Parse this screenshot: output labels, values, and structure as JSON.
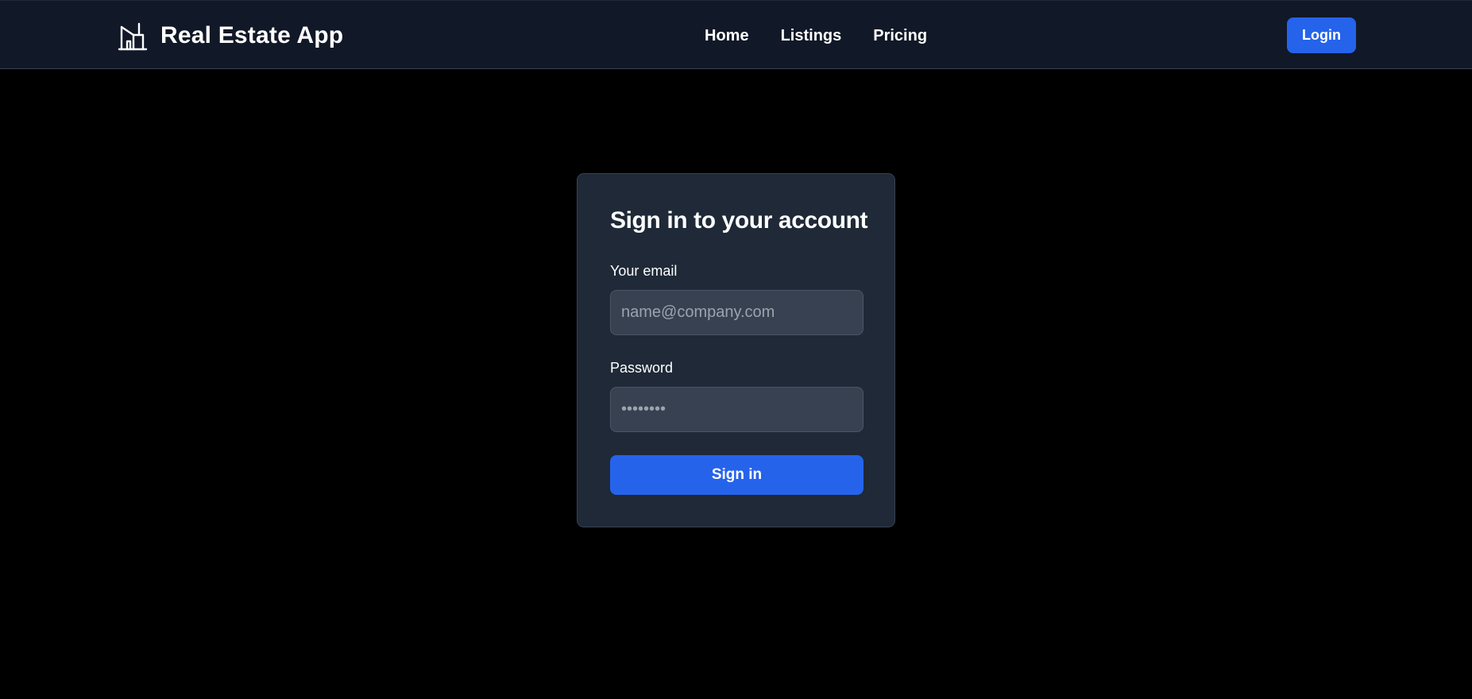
{
  "header": {
    "brand_name": "Real Estate App",
    "brand_icon": "building-icon",
    "nav": [
      "Home",
      "Listings",
      "Pricing"
    ],
    "login_label": "Login"
  },
  "signin_card": {
    "title": "Sign in to your account",
    "email_label": "Your email",
    "email_placeholder": "name@company.com",
    "email_value": "",
    "password_label": "Password",
    "password_placeholder": "••••••••",
    "password_value": "",
    "submit_label": "Sign in"
  },
  "colors": {
    "page_background": "#000000",
    "navbar_background": "#111827",
    "card_background": "#1f2937",
    "input_background": "#374151",
    "accent": "#2563eb",
    "placeholder_text": "#9ca3af"
  }
}
